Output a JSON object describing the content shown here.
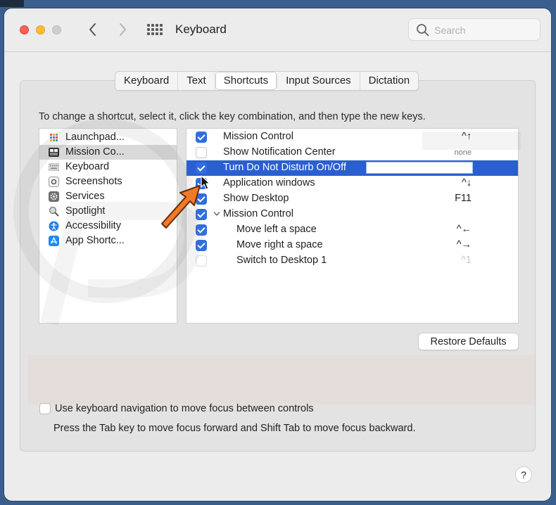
{
  "window": {
    "title": "Keyboard"
  },
  "search": {
    "placeholder": "Search"
  },
  "tabs": [
    {
      "label": "Keyboard",
      "active": false
    },
    {
      "label": "Text",
      "active": false
    },
    {
      "label": "Shortcuts",
      "active": true
    },
    {
      "label": "Input Sources",
      "active": false
    },
    {
      "label": "Dictation",
      "active": false
    }
  ],
  "instruction": "To change a shortcut, select it, click the key combination, and then type the new keys.",
  "sidebar": {
    "items": [
      {
        "label": "Launchpad...",
        "icon": "launchpad-icon",
        "selected": false
      },
      {
        "label": "Mission Co...",
        "icon": "mission-control-icon",
        "selected": true
      },
      {
        "label": "Keyboard",
        "icon": "keyboard-icon",
        "selected": false
      },
      {
        "label": "Screenshots",
        "icon": "screenshot-icon",
        "selected": false
      },
      {
        "label": "Services",
        "icon": "gear-icon",
        "selected": false
      },
      {
        "label": "Spotlight",
        "icon": "spotlight-icon",
        "selected": false
      },
      {
        "label": "Accessibility",
        "icon": "accessibility-icon",
        "selected": false
      },
      {
        "label": "App Shortc...",
        "icon": "app-store-icon",
        "selected": false
      }
    ]
  },
  "shortcuts": {
    "rows": [
      {
        "label": "Mission Control",
        "key": "^↑",
        "checked": true,
        "selected": false
      },
      {
        "label": "Show Notification Center",
        "key": "none",
        "checked": false,
        "selected": false
      },
      {
        "label": "Turn Do Not Disturb On/Off",
        "key": "",
        "checked": true,
        "selected": true
      },
      {
        "label": "Application windows",
        "key": "^↓",
        "checked": true,
        "selected": false
      },
      {
        "label": "Show Desktop",
        "key": "F11",
        "checked": true,
        "selected": false
      },
      {
        "label": "Mission Control",
        "key": "",
        "checked": true,
        "selected": false
      },
      {
        "label": "Move left a space",
        "key": "^←",
        "checked": true,
        "selected": false
      },
      {
        "label": "Move right a space",
        "key": "^→",
        "checked": true,
        "selected": false
      },
      {
        "label": "Switch to Desktop 1",
        "key": "^1",
        "checked": false,
        "selected": false
      }
    ]
  },
  "restore_defaults": "Restore Defaults",
  "keyboard_navigation": {
    "label": "Use keyboard navigation to move focus between controls",
    "hint": "Press the Tab key to move focus forward and Shift Tab to move focus backward.",
    "checked": false
  },
  "help": "?",
  "colors": {
    "accent": "#2f6ee0",
    "selection": "#2a5fd0",
    "annotation_arrow": "#f07a2a"
  }
}
